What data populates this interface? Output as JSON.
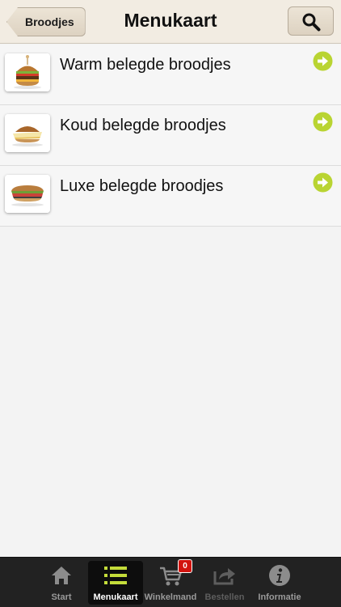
{
  "header": {
    "back_label": "Broodjes",
    "title": "Menukaart",
    "search_icon": "search-icon"
  },
  "list": {
    "items": [
      {
        "label": "Warm belegde broodjes",
        "thumb": "burger-thumbnail",
        "action_icon": "arrow-right-circle-icon"
      },
      {
        "label": "Koud belegde broodjes",
        "thumb": "bun-sandwich-thumbnail",
        "action_icon": "arrow-right-circle-icon"
      },
      {
        "label": "Luxe belegde broodjes",
        "thumb": "baguette-sandwich-thumbnail",
        "action_icon": "arrow-right-circle-icon"
      }
    ]
  },
  "tabbar": {
    "tabs": [
      {
        "label": "Start",
        "icon": "home-icon",
        "state": "normal"
      },
      {
        "label": "Menukaart",
        "icon": "list-icon",
        "state": "active"
      },
      {
        "label": "Winkelmand",
        "icon": "cart-icon",
        "state": "normal",
        "badge": "0"
      },
      {
        "label": "Bestellen",
        "icon": "share-icon",
        "state": "disabled"
      },
      {
        "label": "Informatie",
        "icon": "info-icon",
        "state": "normal"
      }
    ]
  },
  "colors": {
    "navbar_bg": "#f2ece2",
    "accent_green": "#b9d432",
    "active_tab_icon": "#c4dc3a",
    "badge_red": "#d2140f",
    "tabbar_bg": "#222222"
  }
}
